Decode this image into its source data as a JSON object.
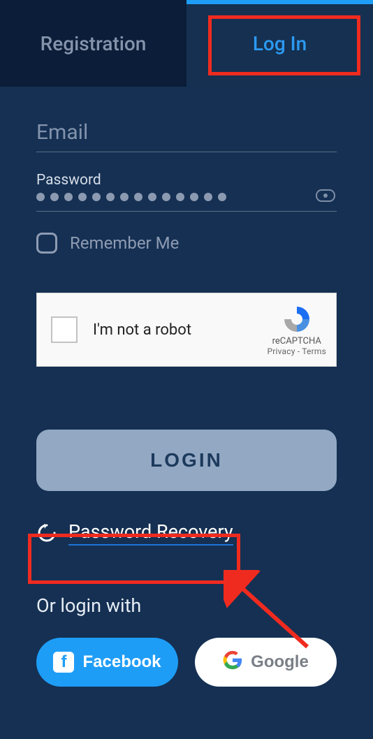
{
  "tabs": {
    "registration": "Registration",
    "login": "Log In"
  },
  "form": {
    "email_label": "Email",
    "password_label": "Password",
    "password_masked_dots": 14,
    "remember_label": "Remember Me"
  },
  "captcha": {
    "text": "I'm not a robot",
    "brand": "reCAPTCHA",
    "links": "Privacy - Terms"
  },
  "actions": {
    "login_button": "LOGIN",
    "recovery": "Password Recovery",
    "or_login_with": "Or login with",
    "facebook": "Facebook",
    "google": "Google"
  }
}
